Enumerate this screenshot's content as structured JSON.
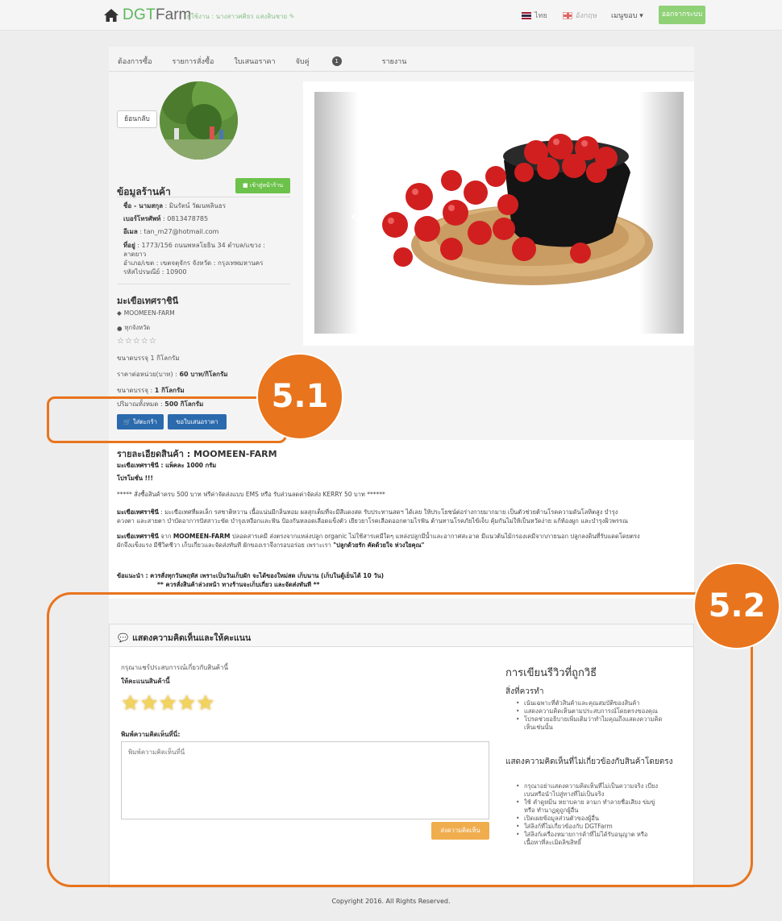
{
  "header": {
    "brand_dgt": "DGT",
    "brand_farm": "Farm",
    "seller_label": "ผู้ใช้งาน : นางสาวศศิธร แสงสินชาย",
    "lang_th": "ไทย",
    "lang_en": "อังกฤษ",
    "menu": "เมนูขอบ ▾",
    "logout": "ออกจากระบบ"
  },
  "tabs": {
    "t1": "ต้องการซื้อ",
    "t2": "รายการสั่งซื้อ",
    "t3": "ใบเสนอราคา",
    "t4": "จับคู่",
    "t4_badge": "1",
    "t5": "รายงาน"
  },
  "back": "ย้อนกลับ",
  "shop": {
    "title": "ข้อมูลร้านค้า",
    "map_btn": "เข้าสู่หน้าร้าน",
    "name_label": "ชื่อ - นามสกุล",
    "name": " : มินรัตน์ วัฒนพลินธร",
    "phone_label": "เบอร์โทรศัพท์",
    "phone": " : 0813478785",
    "email_label": "อีเมล",
    "email": " : tan_m27@hotmail.com",
    "addr_label": "ที่อยู่",
    "addr1": " : 1773/156 ถนนพหลโยธิน 34 ตำบล/แขวง :",
    "addr2": "ลาดยาว",
    "addr3": "อำเภอ/เขต : เขตจตุจักร จังหวัด : กรุงเทพมหานคร",
    "addr4": "รหัสไปรษณีย์ : 10900"
  },
  "product": {
    "name": "มะเขือเทศราชินี",
    "farm": "MOOMEEN-FARM",
    "location": "ทุกจังหวัด",
    "stars": "☆☆☆☆☆",
    "pack": "ขนาดบรรจุ 1 กิโลกรัม",
    "price_label": "ราคาต่อหน่วย(บาท) :",
    "price": "60 บาท/กิโลกรัม",
    "pack2_label": "ขนาดบรรจุ :",
    "pack2": "1 กิโลกรัม",
    "total_label": "ปริมาณทั้งหมด :",
    "total": "500 กิโลกรัม",
    "cart_btn": "ใส่ตะกร้า",
    "quote_btn": "ขอใบเสนอราคา"
  },
  "detail": {
    "title": "รายละเอียดสินค้า : MOOMEEN-FARM",
    "line1": "มะเขือเทศราชินี : แพ็คละ 1000 กรัม",
    "promo": "โปรโมชั่น !!!",
    "promo_text": "***** สั่งซื้อสินค้าครบ 500 บาท ฟรีค่าจัดส่งแบบ EMS หรือ รับส่วนลดค่าจัดส่ง KERRY 50 บาท ******",
    "p1_label": "มะเขือเทศราชินี",
    "p1a": " : มะเขือเทศที่ผลเล็ก รสชาติหวาน เนื้อแน่นมีกลิ่นหอม ผลสุกเต็มที่จะมีสีแดงสด รับประทานสดฯ ได้เลย ให้ประโยชน์ต่อร่างกายมากมาย เป็นตัวช่วยต้านโรคความดันโลหิตสูง บำรุง",
    "p1b": "ดวงตา และสายตา บำบัดอาการปัสสาวะขัด บำรุงเหงือกและฟัน ป้องกันหลอดเลือดแข็งตัว เยียวยาโรคเลือดออกตามไรฟัน ต้านทานโรคภัยไข้เจ็บ คุ้มกันไม่ให้เป็นหวัดง่าย แก้ท้องผูก และบำรุงผิวพรรณ",
    "p2_label": "มะเขือเทศราชินี",
    "p2_mid": " จาก ",
    "p2_farm": "MOOMEEN-FARM",
    "p2a": " ปลอดสารเคมี ส่งตรงจากแหล่งปลูก organic ไม่ใช้สารเคมีใดๆ แหล่งปลูกมีน้ำและอากาศสะอาด มีแนวต้นไม้กรองเคมีจากภายนอก ปลูกลงดินที่รับแดดโดยตรง",
    "p2b": "ผักจึงแข็งแรง มีชีวิตชีวา เก็บเกี่ยวและจัดส่งทันที ผักของเราจึงกรอบอร่อย เพราะเรา ",
    "p2_slogan": "\"ปลูกด้วยรัก คัดด้วยใจ ห่วงใยคุณ\"",
    "advice": "ข้อแนะนำ : ควรสั่งทุกวันพฤหัส เพราะเป็นวันเก็บผัก จะได้ของใหม่สด เก็บนาน (เก็บในตู้เย็นได้ 10 วัน)",
    "advice2": "** ควรสั่งสินค้าล่วงหน้า ทางร้านจะเก็บเกี่ยว และจัดส่งทันที **"
  },
  "review": {
    "title": "แสดงความคิดเห็นและให้คะแนน",
    "prompt": "กรุณาแชร์ประสบการณ์เกี่ยวกับสินค้านี้",
    "rate_label": "ให้คะแนนสินค้านี้",
    "rating": 5,
    "stars": "★★★★★",
    "comment_label": "พิมพ์ความคิดเห็นที่นี่:",
    "comment_placeholder": "พิมพ์ความคิดเห็นที่นี่",
    "submit": "ส่งความคิดเห็น",
    "guide_title": "การเขียนรีวิวที่ถูกวิธี",
    "do_title": "สิ่งที่ควรทำ",
    "do1": "เน้นเฉพาะที่ตัวสินค้าและคุณสมบัติของสินค้า",
    "do2": "แสดงความคิดเห็นตามประสบการณ์โดยตรงของคุณ",
    "do3a": "โปรดช่วยอธิบายเพิ่มเติมว่าทำไมคุณถึงแสดงความคิด",
    "do3b": "เห็นเช่นนั้น",
    "dont_title": "แสดงความคิดเห็นที่ไม่เกี่ยวข้องกับสินค้าโดยตรง",
    "dont1a": "กรุณาอย่าแสดงความคิดเห็นที่ไม่เป็นความจริง เบี่ยง",
    "dont1b": "เบนหรือนำไปสู่ทางที่ไม่เป็นจริง",
    "dont2a": "ใช้ คำดูหมิ่น หยาบคาย ลามก ทำลายชื่อเสียง ข่มขู่",
    "dont2b": "หรือ ทำนาฏดูถูกผู้อื่น",
    "dont3": "เปิดเผยข้อมูลส่วนตัวของผู้อื่น",
    "dont4": "ใส่ลิงก์ที่ไม่เกี่ยวข้องกับ DGTFarm",
    "dont5a": "ใส่ลิงก์เครื่องหมายการค้าที่ไม่ได้รับอนุญาต หรือ",
    "dont5b": "เนื้อหาที่ละเมิดลิขสิทธิ์"
  },
  "footer": "Copyright 2016. All Rights Reserved.",
  "callouts": {
    "c1": "5.1",
    "c2": "5.2"
  },
  "colors": {
    "brand_green": "#5cb85c",
    "primary_blue": "#2b6aad",
    "callout_orange": "#e8741d",
    "submit_orange": "#f0ad4e"
  }
}
